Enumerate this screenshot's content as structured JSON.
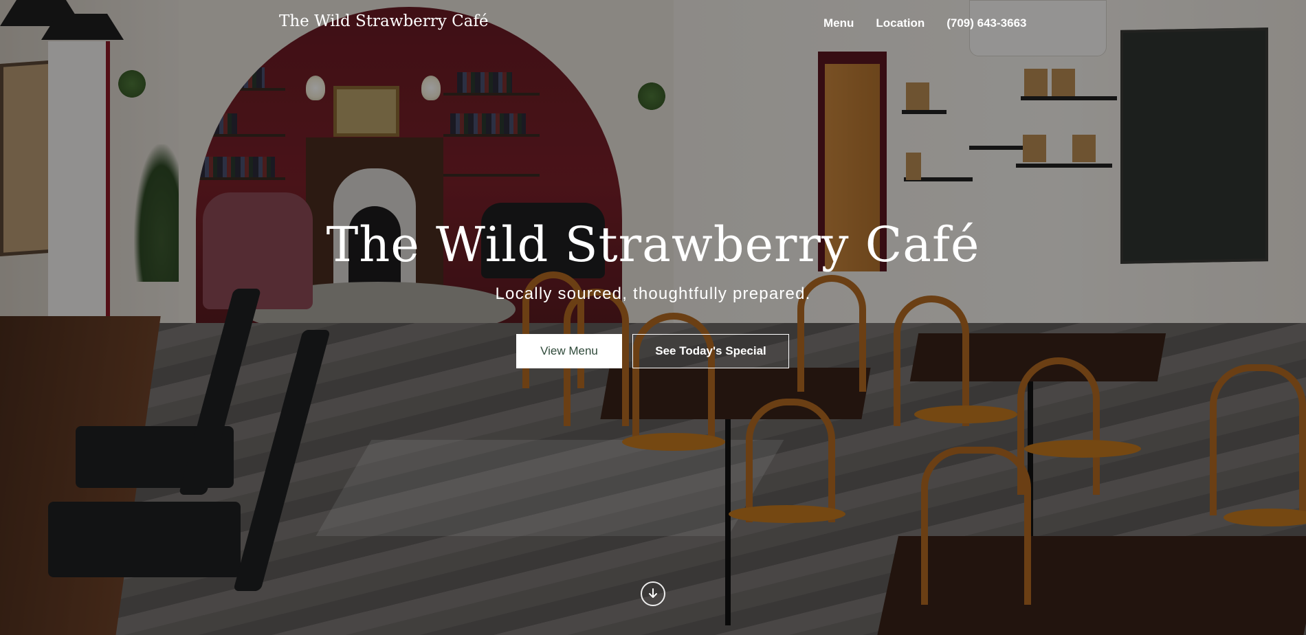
{
  "header": {
    "brand": "The Wild Strawberry Café",
    "nav": [
      {
        "label": "Menu"
      },
      {
        "label": "Location"
      },
      {
        "label": "(709) 643-3663"
      }
    ]
  },
  "hero": {
    "title": "The Wild Strawberry Café",
    "subtitle": "Locally sourced, thoughtfully prepared.",
    "primary_button": "View Menu",
    "secondary_button": "See Today's Special",
    "scroll_icon": "arrow-down-circle-icon"
  },
  "colors": {
    "primary_button_text": "#2f4a3a",
    "text": "#ffffff",
    "overlay": "rgba(0,0,0,0.40)"
  }
}
